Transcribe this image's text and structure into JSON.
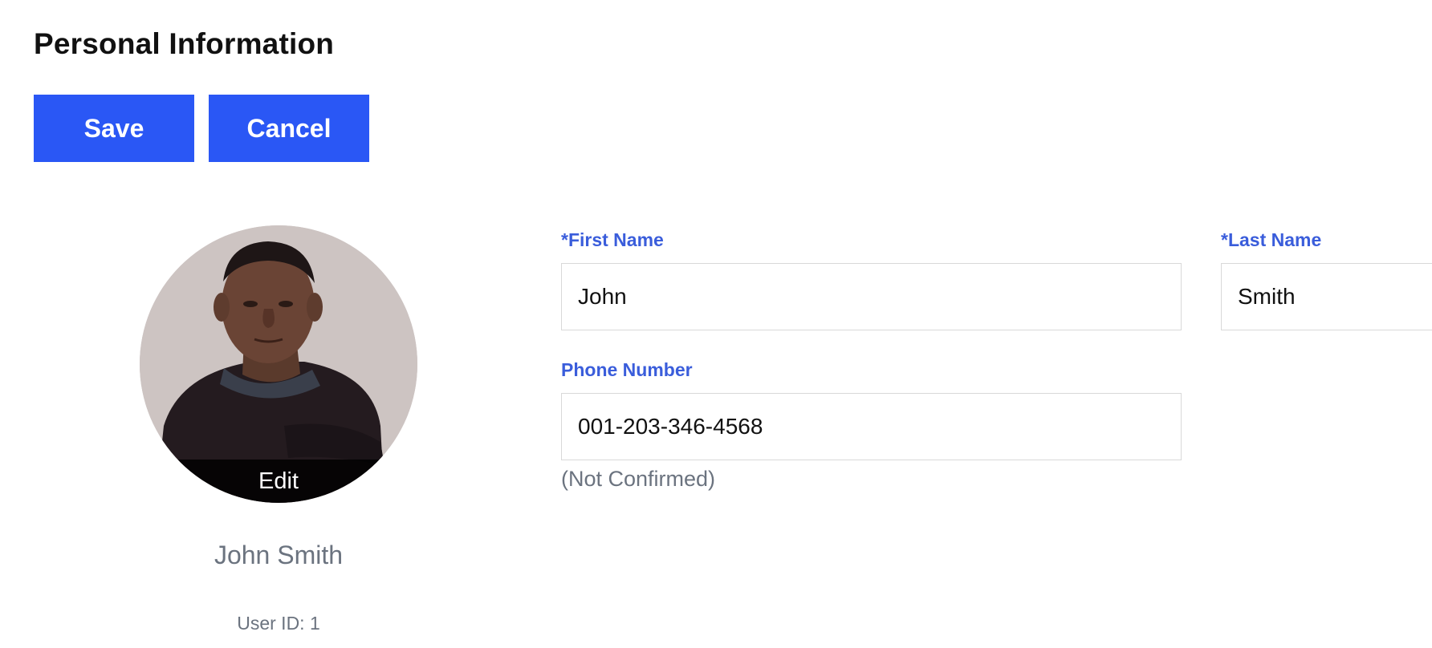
{
  "header": {
    "title": "Personal Information"
  },
  "actions": {
    "save_label": "Save",
    "cancel_label": "Cancel"
  },
  "profile": {
    "edit_label": "Edit",
    "display_name": "John Smith",
    "user_id_label": "User ID:",
    "user_id_value": "1"
  },
  "form": {
    "first_name": {
      "label": "*First Name",
      "value": "John"
    },
    "last_name": {
      "label": "*Last Name",
      "value": "Smith"
    },
    "phone": {
      "label": "Phone Number",
      "value": "001-203-346-4568",
      "status": "(Not Confirmed)"
    }
  },
  "colors": {
    "primary_button": "#2a57f5",
    "label_blue": "#3a5ddb",
    "muted_text": "#6b737f"
  }
}
